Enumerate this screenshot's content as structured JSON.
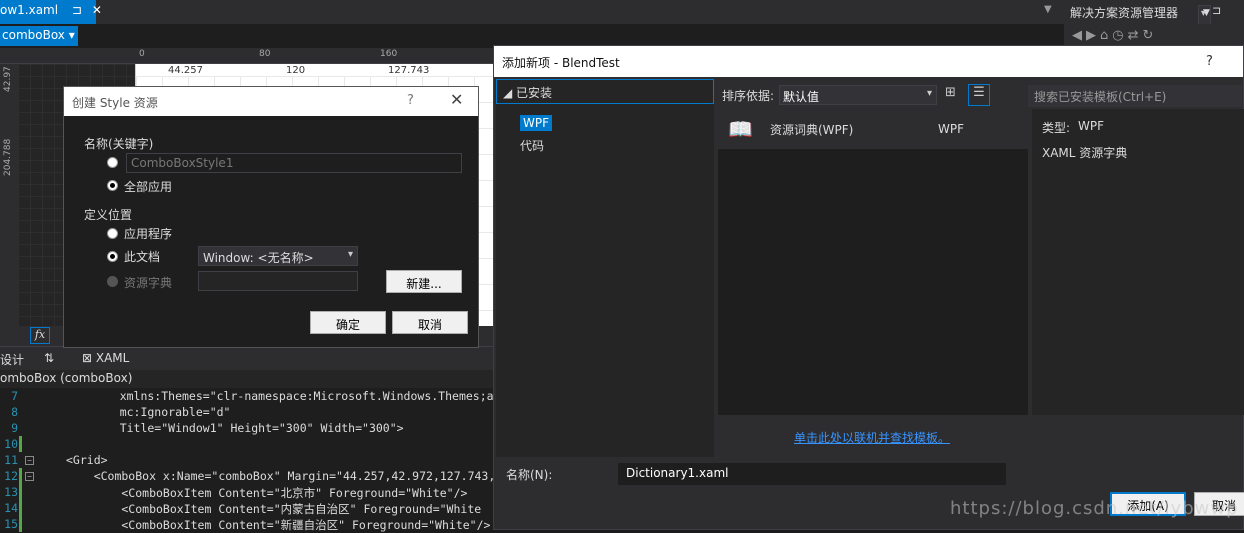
{
  "ide": {
    "doc_tab": "ow1.xaml",
    "doc_tab_pin": "⊐",
    "doc_tab_close": "✕",
    "solution_title": "解决方案资源管理器",
    "combo_selector": "comboBox ▾",
    "ruler_top": [
      "0",
      "80",
      "160"
    ],
    "ruler_left": [
      "42.97",
      "204.788"
    ],
    "dim_labels": [
      "44.257",
      "120",
      "127.743"
    ],
    "split_tabs": {
      "design": "设计",
      "swap": "⇅",
      "xaml": "⊠ XAML"
    },
    "xaml_crumb": "omboBox (comboBox)",
    "fx": "fx"
  },
  "code": {
    "lines": [
      {
        "num": "7",
        "text": "    xmlns:Themes=\"clr-namespace:Microsoft.Windows.Themes;assem"
      },
      {
        "num": "8",
        "text": "    mc:Ignorable=\"d\""
      },
      {
        "num": "9",
        "text": "    Title=\"Window1\" Height=\"300\" Width=\"300\">"
      },
      {
        "num": "10",
        "text": ""
      },
      {
        "num": "11",
        "text": "<Grid>"
      },
      {
        "num": "12",
        "text": "    <ComboBox x:Name=\"comboBox\" Margin=\"44.257,42.972,127.743,"
      },
      {
        "num": "13",
        "text": "        <ComboBoxItem Content=\"北京市\" Foreground=\"White\"/>"
      },
      {
        "num": "14",
        "text": "        <ComboBoxItem Content=\"内蒙古自治区\" Foreground=\"White"
      },
      {
        "num": "15",
        "text": "        <ComboBoxItem Content=\"新疆自治区\" Foreground=\"White\"/>"
      }
    ]
  },
  "style_dialog": {
    "title": "创建 Style 资源",
    "help": "?",
    "close": "✕",
    "name_section": "名称(关键字)",
    "name_placeholder": "ComboBoxStyle1",
    "apply_all": "全部应用",
    "define_section": "定义位置",
    "app_option": "应用程序",
    "this_doc_option": "此文档",
    "doc_dropdown": "Window: <无名称>",
    "resource_dict_option": "资源字典",
    "new_button": "新建...",
    "ok_button": "确定",
    "cancel_button": "取消"
  },
  "add_dialog": {
    "title": "添加新项 - BlendTest",
    "help": "?",
    "installed": "◢  已安装",
    "tree_wpf": "WPF",
    "tree_code": "代码",
    "sort_label": "排序依据:",
    "sort_value": "默认值",
    "search_placeholder": "搜索已安装模板(Ctrl+E)",
    "item_name": "资源词典(WPF)",
    "item_type": "WPF",
    "detail_type_label": "类型:",
    "detail_type_value": "WPF",
    "detail_desc": "XAML 资源字典",
    "find_online": "单击此处以联机并查找模板。",
    "name_label": "名称(N):",
    "name_value": "Dictionary1.xaml",
    "add_button": "添加(A)",
    "cancel_button": "取消"
  },
  "watermark": "https://blog.csdn.net/lybwwp"
}
